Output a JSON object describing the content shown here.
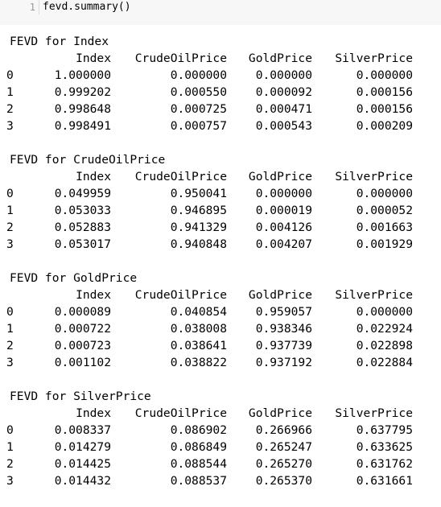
{
  "input_cell": {
    "line_number": "1",
    "code": "fevd.summary()"
  },
  "output": {
    "columns": [
      "Index",
      "CrudeOilPrice",
      "GoldPrice",
      "SilverPrice"
    ],
    "blocks": [
      {
        "title": "FEVD for Index",
        "rows": [
          {
            "idx": "0",
            "values": [
              "1.000000",
              "0.000000",
              "0.000000",
              "0.000000"
            ]
          },
          {
            "idx": "1",
            "values": [
              "0.999202",
              "0.000550",
              "0.000092",
              "0.000156"
            ]
          },
          {
            "idx": "2",
            "values": [
              "0.998648",
              "0.000725",
              "0.000471",
              "0.000156"
            ]
          },
          {
            "idx": "3",
            "values": [
              "0.998491",
              "0.000757",
              "0.000543",
              "0.000209"
            ]
          }
        ]
      },
      {
        "title": "FEVD for CrudeOilPrice",
        "rows": [
          {
            "idx": "0",
            "values": [
              "0.049959",
              "0.950041",
              "0.000000",
              "0.000000"
            ]
          },
          {
            "idx": "1",
            "values": [
              "0.053033",
              "0.946895",
              "0.000019",
              "0.000052"
            ]
          },
          {
            "idx": "2",
            "values": [
              "0.052883",
              "0.941329",
              "0.004126",
              "0.001663"
            ]
          },
          {
            "idx": "3",
            "values": [
              "0.053017",
              "0.940848",
              "0.004207",
              "0.001929"
            ]
          }
        ]
      },
      {
        "title": "FEVD for GoldPrice",
        "rows": [
          {
            "idx": "0",
            "values": [
              "0.000089",
              "0.040854",
              "0.959057",
              "0.000000"
            ]
          },
          {
            "idx": "1",
            "values": [
              "0.000722",
              "0.038008",
              "0.938346",
              "0.022924"
            ]
          },
          {
            "idx": "2",
            "values": [
              "0.000723",
              "0.038641",
              "0.937739",
              "0.022898"
            ]
          },
          {
            "idx": "3",
            "values": [
              "0.001102",
              "0.038822",
              "0.937192",
              "0.022884"
            ]
          }
        ]
      },
      {
        "title": "FEVD for SilverPrice",
        "rows": [
          {
            "idx": "0",
            "values": [
              "0.008337",
              "0.086902",
              "0.266966",
              "0.637795"
            ]
          },
          {
            "idx": "1",
            "values": [
              "0.014279",
              "0.086849",
              "0.265247",
              "0.633625"
            ]
          },
          {
            "idx": "2",
            "values": [
              "0.014425",
              "0.088544",
              "0.265270",
              "0.631762"
            ]
          },
          {
            "idx": "3",
            "values": [
              "0.014432",
              "0.088537",
              "0.265370",
              "0.631661"
            ]
          }
        ]
      }
    ]
  }
}
